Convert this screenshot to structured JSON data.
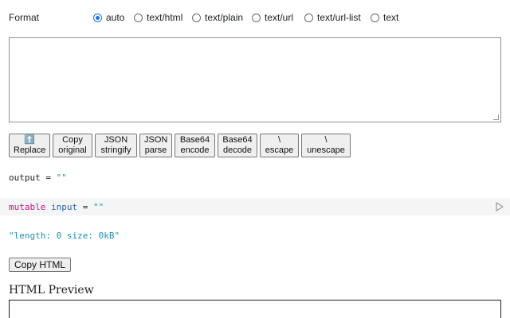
{
  "format": {
    "label": "Format",
    "options": [
      {
        "label": "auto",
        "checked": true
      },
      {
        "label": "text/html",
        "checked": false
      },
      {
        "label": "text/plain",
        "checked": false
      },
      {
        "label": "text/url",
        "checked": false
      },
      {
        "label": "text/url-list",
        "checked": false
      },
      {
        "label": "text",
        "checked": false
      }
    ]
  },
  "input": {
    "value": ""
  },
  "buttons": [
    {
      "line1": "⬆️",
      "line2": "Replace"
    },
    {
      "line1": "Copy",
      "line2": "original"
    },
    {
      "line1": "JSON",
      "line2": "stringify"
    },
    {
      "line1": "JSON",
      "line2": "parse"
    },
    {
      "line1": "Base64",
      "line2": "encode"
    },
    {
      "line1": "Base64",
      "line2": "decode"
    },
    {
      "line1": "\\",
      "line2": "escape"
    },
    {
      "line1": "\\",
      "line2": "unescape"
    }
  ],
  "output_cell": {
    "name": "output",
    "op": " = ",
    "value": "\"\""
  },
  "mutable_cell": {
    "keyword": "mutable",
    "name": "input",
    "op": " = ",
    "value": "\"\""
  },
  "length_cell": {
    "value": "\"length: 0 size: 0kB\""
  },
  "copy_html_label": "Copy HTML",
  "preview_title": "HTML Preview",
  "icons": {
    "run": "play-icon"
  },
  "colors": {
    "string": "#1d8fb5",
    "keyword": "#c0178b",
    "variable": "#2b66b0",
    "radio_accent": "#1a73e8"
  }
}
